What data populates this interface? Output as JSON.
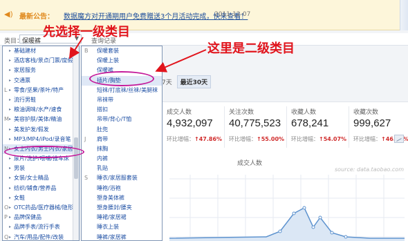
{
  "notice": {
    "label": "最新公告：",
    "message": "数据魔方对开通期用户免费赠送3个月活动完成，快来查看！",
    "date": "2011-12-07"
  },
  "filter": {
    "category_label": "类目：",
    "category_value": "保暖裤",
    "query_record": "查询记录"
  },
  "annotations": {
    "first": "先选择一级类目",
    "second": "这里是二级类目"
  },
  "level1": [
    {
      "letter": "",
      "label": "基础建材"
    },
    {
      "letter": "",
      "label": "酒店客栈/景点门票/度假旅游"
    },
    {
      "letter": "",
      "label": "家居服务"
    },
    {
      "letter": "",
      "label": "交通票"
    },
    {
      "letter": "L",
      "label": "零食/坚果/茶叶/特产"
    },
    {
      "letter": "",
      "label": "流行男鞋"
    },
    {
      "letter": "",
      "label": "粮油调味/水产/速食"
    },
    {
      "letter": "M",
      "label": "美容护肤/美体/精油"
    },
    {
      "letter": "",
      "label": "美发护发/假发"
    },
    {
      "letter": "",
      "label": "MP3/MP4/iPod/录音笔"
    },
    {
      "letter": "N",
      "label": "女士内衣/男士内衣/家居服"
    },
    {
      "letter": "",
      "label": "尿片/洗护/喂哺/推车床"
    },
    {
      "letter": "",
      "label": "男装"
    },
    {
      "letter": "",
      "label": "女装/女士精品"
    },
    {
      "letter": "",
      "label": "纺织/辅食/营养品"
    },
    {
      "letter": "",
      "label": "女鞋"
    },
    {
      "letter": "O",
      "label": "OTC药品/医疗器械/隐形眼镜"
    },
    {
      "letter": "P",
      "label": "品牌保健品"
    },
    {
      "letter": "",
      "label": "品牌手表/流行手表"
    },
    {
      "letter": "Q",
      "label": "汽车/用品/配件/改装"
    }
  ],
  "level2": [
    {
      "letter": "B",
      "label": "保暖套装"
    },
    {
      "letter": "",
      "label": "保暖上装"
    },
    {
      "letter": "",
      "label": "保暖裤"
    },
    {
      "letter": "",
      "label": "插片/胸垫"
    },
    {
      "letter": "",
      "label": "短袜/打底袜/丝袜/美腿袜"
    },
    {
      "letter": "",
      "label": "吊袜带"
    },
    {
      "letter": "",
      "label": "搭扣"
    },
    {
      "letter": "",
      "label": "吊带/背心/T恤"
    },
    {
      "letter": "",
      "label": "肚兜"
    },
    {
      "letter": "J",
      "label": "肩带"
    },
    {
      "letter": "",
      "label": "抹胸"
    },
    {
      "letter": "",
      "label": "内裤"
    },
    {
      "letter": "",
      "label": "乳贴"
    },
    {
      "letter": "S",
      "label": "睡衣/家居服套装"
    },
    {
      "letter": "",
      "label": "睡袍/浴袍"
    },
    {
      "letter": "",
      "label": "塑身美体裤"
    },
    {
      "letter": "",
      "label": "塑身腰封/腰夹"
    },
    {
      "letter": "",
      "label": "睡裙/家居裙"
    },
    {
      "letter": "",
      "label": "睡衣上装"
    },
    {
      "letter": "",
      "label": "睡裤/家居裤"
    }
  ],
  "date_tabs": [
    "7天",
    "最近30天"
  ],
  "stats": [
    {
      "title": "成交人数",
      "value": "4,932,097",
      "change_label": "环比增幅：",
      "change": "↑47.86%"
    },
    {
      "title": "关注次数",
      "value": "40,775,523",
      "change_label": "环比增幅：",
      "change": "↑55.00%"
    },
    {
      "title": "收藏人数",
      "value": "678,241",
      "change_label": "环比增幅：",
      "change": "↑54.07%"
    },
    {
      "title": "收藏次数",
      "value": "999,627",
      "change_label": "环比增幅：",
      "change": "↑46.10%"
    }
  ],
  "chart": {
    "title": "成交人数",
    "source": "source: data.taobao.com"
  },
  "colors": {
    "annotation": "#e1141c",
    "highlight_ellipse": "#c41a9a",
    "link": "#1c4ea3",
    "increase": "#d02b2b"
  }
}
